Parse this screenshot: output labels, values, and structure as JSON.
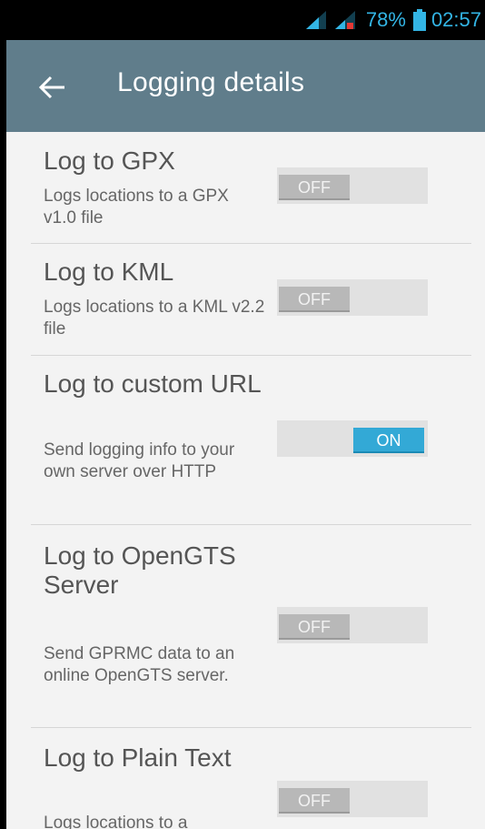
{
  "status_bar": {
    "battery_percent": "78%",
    "time": "02:57",
    "accent_color": "#33b5e5"
  },
  "app_bar": {
    "back_icon": "arrow-left-icon",
    "title": "Logging details",
    "background_color": "#607d8b"
  },
  "settings": [
    {
      "title": "Log to GPX",
      "summary": "Logs locations to a GPX v1.0 file",
      "state": "off",
      "state_label": "OFF"
    },
    {
      "title": "Log to KML",
      "summary": "Logs locations to a KML v2.2 file",
      "state": "off",
      "state_label": "OFF"
    },
    {
      "title": "Log to custom URL",
      "summary": "Send logging info to your own server over HTTP",
      "state": "on",
      "state_label": "ON"
    },
    {
      "title": "Log to OpenGTS Server",
      "summary": "Send GPRMC data to an online OpenGTS server.",
      "state": "off",
      "state_label": "OFF"
    },
    {
      "title": "Log to Plain Text",
      "summary": "Logs locations to a",
      "state": "off",
      "state_label": "OFF"
    }
  ],
  "colors": {
    "switch_on": "#33a9d6",
    "switch_off": "#b8b8b8"
  }
}
